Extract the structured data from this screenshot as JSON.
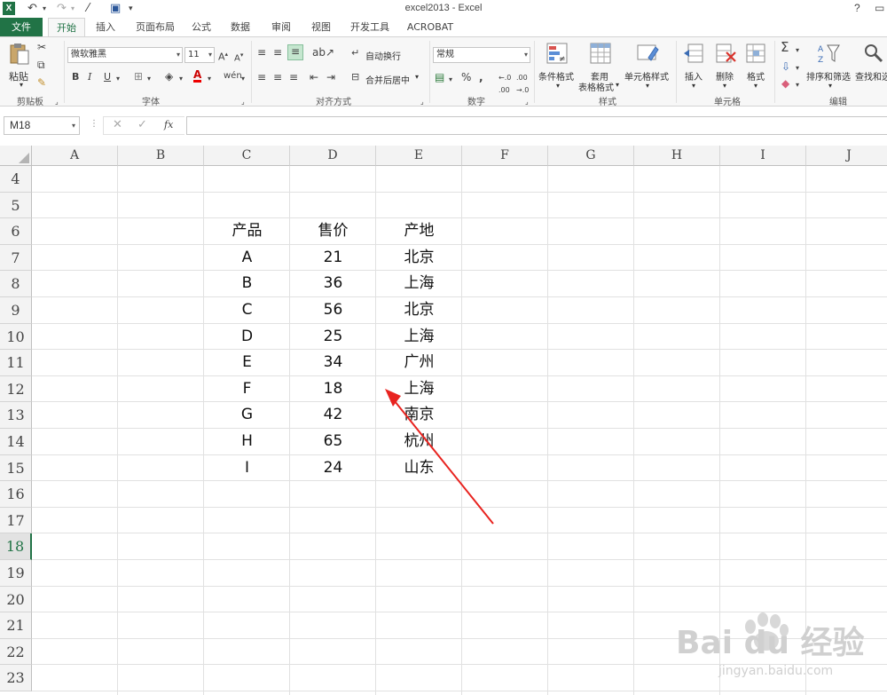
{
  "titlebar": {
    "app_icon": "X",
    "title": "excel2013 - Excel",
    "help": "?"
  },
  "tabs": [
    "文件",
    "开始",
    "插入",
    "页面布局",
    "公式",
    "数据",
    "审阅",
    "视图",
    "开发工具",
    "ACROBAT"
  ],
  "ribbon": {
    "clipboard": {
      "paste": "粘贴",
      "label": "剪贴板"
    },
    "font": {
      "name": "微软雅黑",
      "size": "11",
      "label": "字体"
    },
    "alignment": {
      "wrap": "自动换行",
      "merge": "合并后居中",
      "label": "对齐方式"
    },
    "number": {
      "format": "常规",
      "label": "数字"
    },
    "styles": {
      "conditional": "条件格式",
      "table_l1": "套用",
      "table_l2": "表格格式",
      "cell_style": "单元格样式",
      "label": "样式"
    },
    "cells": {
      "insert": "插入",
      "delete": "删除",
      "format": "格式",
      "label": "单元格"
    },
    "editing": {
      "sort": "排序和筛选",
      "find": "查找和选",
      "label": "编辑"
    }
  },
  "formula_bar": {
    "namebox": "M18",
    "fx": "fx",
    "formula": ""
  },
  "columns": [
    "A",
    "B",
    "C",
    "D",
    "E",
    "F",
    "G",
    "H",
    "I",
    "J"
  ],
  "rows": [
    "4",
    "5",
    "6",
    "7",
    "8",
    "9",
    "10",
    "11",
    "12",
    "13",
    "14",
    "15",
    "16",
    "17",
    "18",
    "19",
    "20",
    "21",
    "22",
    "23"
  ],
  "selected_row": "18",
  "table": {
    "headers": [
      "产品",
      "售价",
      "产地"
    ],
    "rows": [
      [
        "A",
        "21",
        "北京"
      ],
      [
        "B",
        "36",
        "上海"
      ],
      [
        "C",
        "56",
        "北京"
      ],
      [
        "D",
        "25",
        "上海"
      ],
      [
        "E",
        "34",
        "广州"
      ],
      [
        "F",
        "18",
        "上海"
      ],
      [
        "G",
        "42",
        "南京"
      ],
      [
        "H",
        "65",
        "杭州"
      ],
      [
        "I",
        "24",
        "山东"
      ]
    ]
  },
  "annotation": {
    "arrow_color": "#e8231f"
  },
  "colors": {
    "accent": "#217346"
  },
  "watermark": {
    "brand": "Bai du 经验",
    "url": "jingyan.baidu.com"
  }
}
